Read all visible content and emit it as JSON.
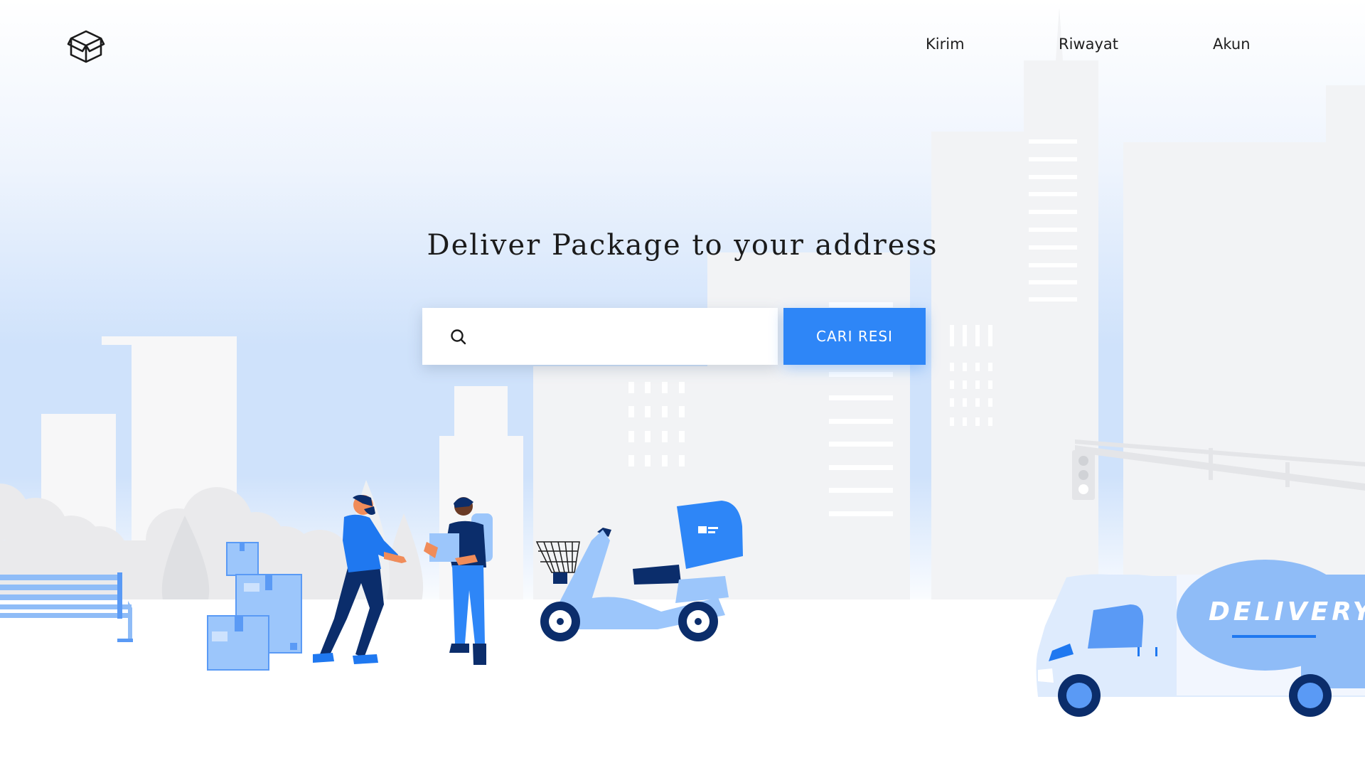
{
  "header": {
    "logo_icon": "package-box-icon",
    "nav": [
      {
        "label": "Kirim"
      },
      {
        "label": "Riwayat"
      },
      {
        "label": "Akun"
      }
    ]
  },
  "hero": {
    "title": "Deliver Package to your address"
  },
  "search": {
    "icon": "search-icon",
    "value": "",
    "placeholder": "",
    "button_label": "CARI RESI"
  },
  "illustration": {
    "van_text": "DELIVERY"
  },
  "colors": {
    "accent": "#2e86f7",
    "primary_blue": "#1f78f0",
    "dark_navy": "#0b2d6b",
    "light_blue": "#9cc6fb",
    "building_gray": "#f2f3f5"
  }
}
